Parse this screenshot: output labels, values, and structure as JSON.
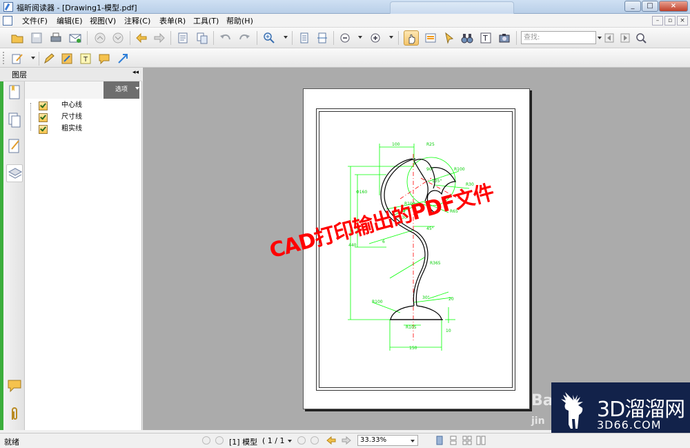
{
  "window": {
    "title": "福昕阅读器 - [Drawing1-模型.pdf]",
    "controls": [
      "_",
      "□",
      "×"
    ]
  },
  "menubar": {
    "items": [
      "文件(F)",
      "编辑(E)",
      "视图(V)",
      "注释(C)",
      "表单(R)",
      "工具(T)",
      "帮助(H)"
    ],
    "mdi_controls": [
      "–",
      "▫",
      "×"
    ]
  },
  "toolbar": {
    "search_placeholder": "查找:"
  },
  "left_panel": {
    "header": "图层",
    "collapse_glyph": "◂◂",
    "options_label": "选项",
    "layers": [
      {
        "name": "中心线",
        "checked": true
      },
      {
        "name": "尺寸线",
        "checked": true
      },
      {
        "name": "粗实线",
        "checked": true
      }
    ]
  },
  "document": {
    "watermark_text": "CAD打印输出的PDF文件",
    "watermark_color": "#ff0000",
    "drawing_labels": {
      "dim_100": "100",
      "r25": "R25",
      "r100_top": "R100",
      "deg90": "90°",
      "deg135": "135°",
      "r30_right": "R30",
      "phi160": "Φ160",
      "r100_mid": "R100",
      "r65": "R65",
      "r144": "R144",
      "r30_left": "R30",
      "deg45": "45°",
      "dim_440": "440",
      "dim_6": "6",
      "r365": "R365",
      "r100_low": "R100",
      "deg30": "30°",
      "dim_20": "20",
      "r105": "R105",
      "dim_10": "10",
      "dim_150": "150"
    }
  },
  "logo": {
    "brand": "3D溜溜网",
    "domain": "3D66.COM",
    "baidu_partial": "Ba",
    "baidu_sub": "jin"
  },
  "statusbar": {
    "status": "就绪",
    "page_label": "[1] 模型",
    "page_count": "( 1 / 1",
    "zoom": "33.33%"
  },
  "colors": {
    "drawing_green": "#00ff00",
    "center_line_red": "#ff0000",
    "outline": "#000000",
    "doc_bg": "#ababab",
    "logo_bg": "#12224a"
  }
}
